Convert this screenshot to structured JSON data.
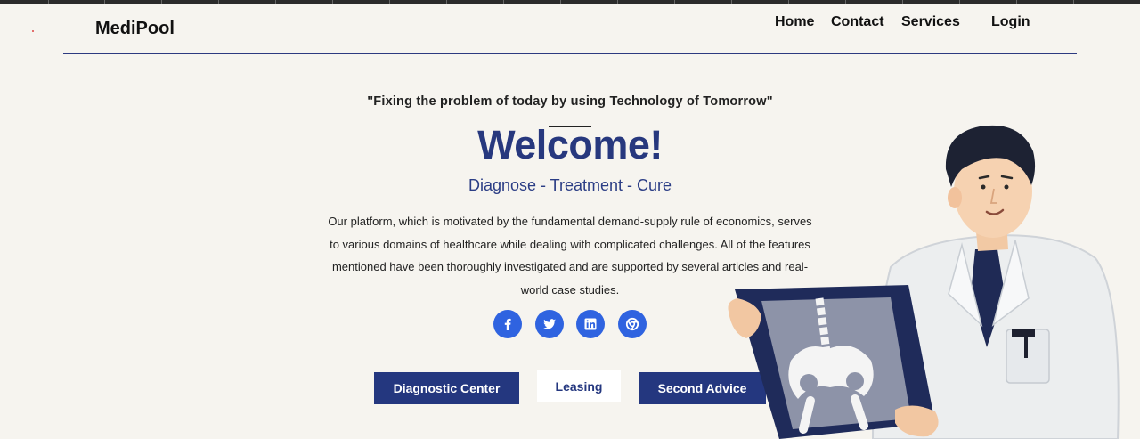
{
  "header": {
    "brand": "MediPool",
    "nav": [
      "Home",
      "Contact",
      "Services",
      "Login"
    ]
  },
  "hero": {
    "quote": "\"Fixing the problem of today by using Technology of Tomorrow\"",
    "title": "Welcome!",
    "tagline": "Diagnose - Treatment - Cure",
    "description": "Our platform, which is motivated by the fundamental demand-supply rule of economics, serves to various domains of healthcare while dealing with complicated challenges. All of the features mentioned have been thoroughly investigated and are supported by several articles and real-world case studies."
  },
  "social": [
    "facebook-icon",
    "twitter-icon",
    "linkedin-icon",
    "chrome-icon"
  ],
  "buttons": {
    "diagnostic": "Diagnostic Center",
    "leasing": "Leasing",
    "second_advice": "Second Advice"
  },
  "colors": {
    "background": "#f6f4ef",
    "brand_blue": "#27387e",
    "social_blue": "#2f63e0"
  }
}
